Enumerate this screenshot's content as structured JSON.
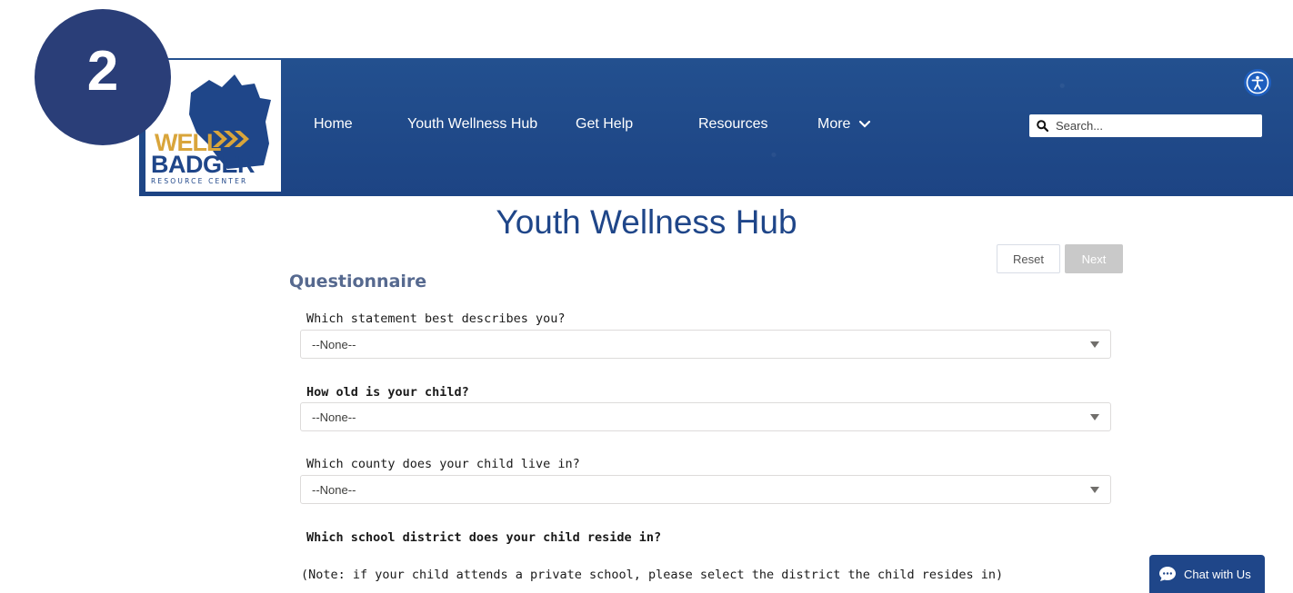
{
  "step_badge": "2",
  "logo": {
    "line1": "WELL",
    "line2": "BADGER",
    "subtitle": "RESOURCE CENTER"
  },
  "nav": {
    "items": [
      {
        "label": "Home"
      },
      {
        "label": "Youth Wellness Hub"
      },
      {
        "label": "Get Help"
      },
      {
        "label": "Resources"
      },
      {
        "label": "More"
      }
    ]
  },
  "search": {
    "placeholder": "Search..."
  },
  "page": {
    "title": "Youth Wellness Hub",
    "reset_label": "Reset",
    "next_label": "Next",
    "section_title": "Questionnaire"
  },
  "questions": [
    {
      "label": "Which statement best describes you?",
      "value": "--None--"
    },
    {
      "label": "How old is your child?",
      "value": "--None--"
    },
    {
      "label": "Which county does your child live in?",
      "value": "--None--"
    },
    {
      "label": "Which school district does your child reside in?"
    }
  ],
  "note": "(Note: if your child attends a private school, please select the district the child resides in)",
  "chat": {
    "label": "Chat with Us"
  },
  "icons": [
    "search-icon",
    "accessibility-icon",
    "chevron-down-icon",
    "dropdown-caret-icon",
    "chat-bubble-icon"
  ],
  "colors": {
    "brand_blue": "#1f4689",
    "logo_gold": "#d9a53b",
    "section_title": "#56698f",
    "next_disabled": "#c9c9c9"
  }
}
